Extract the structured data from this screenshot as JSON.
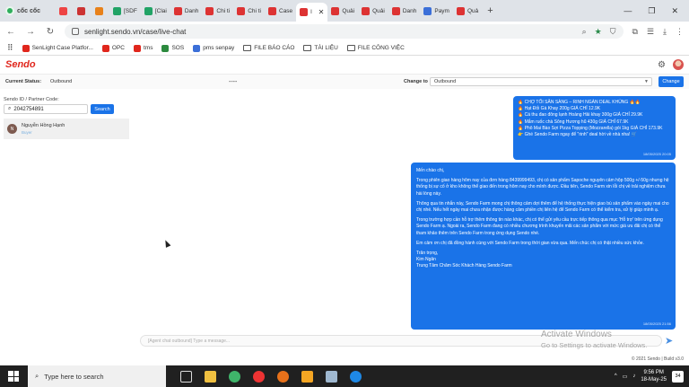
{
  "browser": {
    "brand": "cốc cốc",
    "tabs": [
      {
        "label": "",
        "color": "#e44"
      },
      {
        "label": "",
        "color": "#c33"
      },
      {
        "label": "",
        "color": "#e8811a"
      },
      {
        "label": "[SDF",
        "color": "#21a366"
      },
      {
        "label": "[Clai",
        "color": "#21a366"
      },
      {
        "label": "Danh",
        "color": "#d33"
      },
      {
        "label": "Chi ti",
        "color": "#d33"
      },
      {
        "label": "Chi ti",
        "color": "#d33"
      },
      {
        "label": "Case",
        "color": "#d33"
      },
      {
        "label": "l",
        "color": "#d33",
        "active": true
      },
      {
        "label": "Quải",
        "color": "#d33"
      },
      {
        "label": "Quải",
        "color": "#d33"
      },
      {
        "label": "Danh",
        "color": "#d33"
      },
      {
        "label": "Paym",
        "color": "#3b6fd8"
      },
      {
        "label": "Quả",
        "color": "#d33"
      }
    ],
    "url": "senlight.sendo.vn/case/live-chat",
    "bookmarks": [
      {
        "label": "",
        "type": "apps"
      },
      {
        "label": "SenLight Case Platfor...",
        "type": "site",
        "color": "#e0261c"
      },
      {
        "label": "OPC",
        "type": "site",
        "color": "#e0261c"
      },
      {
        "label": "tms",
        "type": "site",
        "color": "#e0261c"
      },
      {
        "label": "SOS",
        "type": "site",
        "color": "#2c8a3e"
      },
      {
        "label": "pms senpay",
        "type": "site",
        "color": "#3b6fd8"
      },
      {
        "label": "FILE BÁO CÁO",
        "type": "folder"
      },
      {
        "label": "TÀI LIỆU",
        "type": "folder"
      },
      {
        "label": "FILE CÔNG VIỆC",
        "type": "folder"
      }
    ]
  },
  "app": {
    "logo": "Sendo",
    "status_label": "Current Status:",
    "status_value": "Outbound",
    "middle_dots": "----",
    "change_to_label": "Change to",
    "change_to_value": "Outbound",
    "change_button": "Change"
  },
  "left": {
    "id_label": "Sendo ID / Partner Code:",
    "id_value": "2042754891",
    "search_button": "Search",
    "contacts": [
      {
        "initial": "N",
        "name": "Nguyễn Hồng Hạnh",
        "sub": "Buyer"
      }
    ]
  },
  "chat": {
    "promo_lines": [
      "🔥 CHỢ TỐI SĂN SÀNG – RINH NGÀN DEAL KHỦNG 🔥🔥",
      "🔥 Hạt Đối Gà Khay 200g GIÁ CHỈ 12.9K",
      "🔥 Cá thu đao đông lạnh Hoàng Hải khay 300g GIÁ CHỈ 29.9K",
      "🔥 Mắm ruốc chà Sông Hương hũ 430g GIÁ CHỈ 67.9K",
      "🔥 Phô Mai Bào Sợi Pizza Topping (Mozzarella) gói 1kg GIÁ CHỈ 173.9K",
      "👉 Ghé Sendo Farm ngay để \"rinh\" deal hời về nhà nha! 🛒"
    ],
    "promo_time": "18/05/2025 20:05",
    "message_paragraphs": [
      "Mến chào chị,",
      "Trong phiên giao hàng hôm nay của đơn hàng 8439999493, chị có sản phẩm Sapoche nguyên cảm hộp 500g +/-50g nhưng hệ thống bị sự cố ở kho không thể giao đến trong hôm nay cho mình được. Đầu tiên, Sendo Farm xin lỗi chị về trải nghiệm chưa hài lòng này.",
      "Thông qua tin nhắn này, Sendo Farm mong chị thông cảm dợi thêm để hệ thống thực hiện giao bù sản phẩm vào ngày mai cho chị nhé. Nếu hết ngày mai chưa nhận được hàng cảm phiền chị liên hệ để Sendo Farm có thể kiểm tra, xử lý giúp mình ạ.",
      "Trong trường hợp cần hỗ trợ thêm thông tin nào khác, chị có thể gửi yêu cầu trực tiếp thông qua mục 'Hỗ trợ' trên ứng dụng Sendo Farm ạ. Ngoài ra, Sendo Farm đang có nhiều chương trình khuyến mãi các sản phẩm với mức giá ưu đãi chị có thể tham khảo thêm trên Sendo Farm trong ứng dụng Sendo nhé.",
      "Em cảm ơn chị đã đồng hành cùng với Sendo Farm trong thời gian vừa qua. Mến chúc chị có thật nhiều sức khỏe."
    ],
    "signature": [
      "Trân trọng,",
      "Kim Ngân",
      "Trung Tâm Chăm Sóc Khách Hàng Sendo Farm"
    ],
    "message_time": "18/05/2025 21:56",
    "composer_placeholder": "[Agent chat outbound] Type a message..."
  },
  "watermark": {
    "line1": "Activate Windows",
    "line2": "Go to Settings to activate Windows."
  },
  "footer": "© 2021 Sendo | Build v3.0",
  "taskbar": {
    "search_placeholder": "Type here to search",
    "time": "9:56 PM",
    "date": "18-May-25",
    "notifications": "34"
  }
}
